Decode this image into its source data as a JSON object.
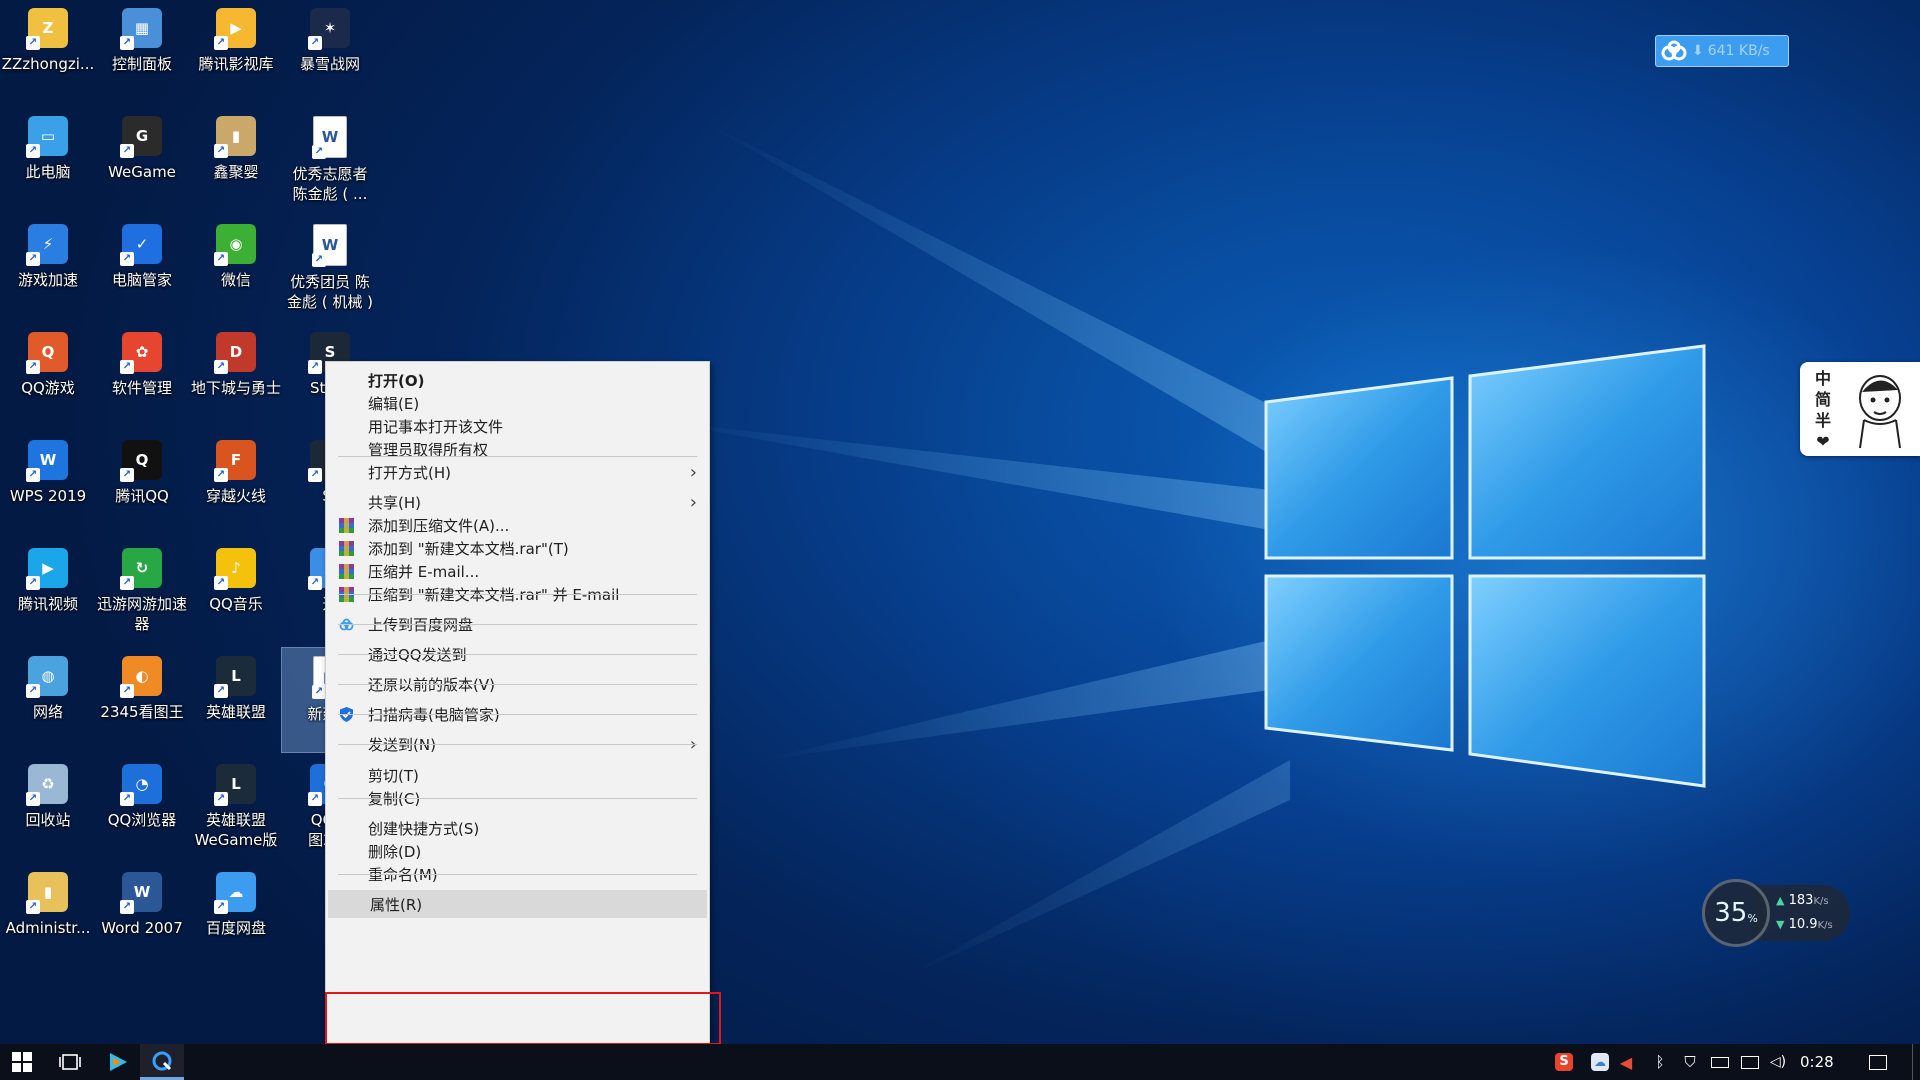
{
  "desktop_icons": [
    {
      "label": "ZZzhongzi...",
      "color": "#f0c040",
      "glyph": "Z"
    },
    {
      "label": "控制面板",
      "color": "#4a90d9",
      "glyph": "▦"
    },
    {
      "label": "腾讯影视库",
      "color": "#f5b830",
      "glyph": "▶"
    },
    {
      "label": "暴雪战网",
      "color": "#1b2a4a",
      "glyph": "✶"
    },
    {
      "label": "此电脑",
      "color": "#3aa0e8",
      "glyph": "▭"
    },
    {
      "label": "WeGame",
      "color": "#2b2b2b",
      "glyph": "G"
    },
    {
      "label": "鑫聚婴",
      "color": "#c9a86a",
      "glyph": "▮"
    },
    {
      "label": "优秀志愿者\n陈金彪 ( ...",
      "color": "#ffffff",
      "glyph": "W"
    },
    {
      "label": "游戏加速",
      "color": "#2a7de1",
      "glyph": "⚡"
    },
    {
      "label": "电脑管家",
      "color": "#1f6fe0",
      "glyph": "✓"
    },
    {
      "label": "微信",
      "color": "#3cb034",
      "glyph": "◉"
    },
    {
      "label": "优秀团员 陈\n金彪 ( 机械 )",
      "color": "#ffffff",
      "glyph": "W"
    },
    {
      "label": "QQ游戏",
      "color": "#e05a2a",
      "glyph": "Q"
    },
    {
      "label": "软件管理",
      "color": "#e6462f",
      "glyph": "✿"
    },
    {
      "label": "地下城与勇士",
      "color": "#c0392b",
      "glyph": "D"
    },
    {
      "label": "Stear",
      "color": "#1b2838",
      "glyph": "S"
    },
    {
      "label": "WPS 2019",
      "color": "#1f75e0",
      "glyph": "W"
    },
    {
      "label": "腾讯QQ",
      "color": "#111111",
      "glyph": "Q"
    },
    {
      "label": "穿越火线",
      "color": "#d9541e",
      "glyph": "F"
    },
    {
      "label": "St",
      "color": "#1b2838",
      "glyph": "S"
    },
    {
      "label": "腾讯视频",
      "color": "#1aa6e8",
      "glyph": "▶"
    },
    {
      "label": "迅游网游加速\n器",
      "color": "#28a745",
      "glyph": "↻"
    },
    {
      "label": "QQ音乐",
      "color": "#f4c20d",
      "glyph": "♪"
    },
    {
      "label": "迅",
      "color": "#3a8ee6",
      "glyph": "X"
    },
    {
      "label": "网络",
      "color": "#4aa3df",
      "glyph": "◍"
    },
    {
      "label": "2345看图王",
      "color": "#f08a24",
      "glyph": "◐"
    },
    {
      "label": "英雄联盟",
      "color": "#1c2b3a",
      "glyph": "L"
    },
    {
      "label": "新建文",
      "color": "#ffffff",
      "glyph": "▤"
    },
    {
      "label": "回收站",
      "color": "#9ab7d3",
      "glyph": "♻"
    },
    {
      "label": "QQ浏览器",
      "color": "#1e6fd9",
      "glyph": "◔"
    },
    {
      "label": "英雄联盟\nWeGame版",
      "color": "#1c2b3a",
      "glyph": "L"
    },
    {
      "label": "QQ浏\n图201",
      "color": "#1e6fd9",
      "glyph": "Q"
    },
    {
      "label": "Administr...",
      "color": "#e8c15a",
      "glyph": "▮"
    },
    {
      "label": "Word 2007",
      "color": "#2b5797",
      "glyph": "W"
    },
    {
      "label": "百度网盘",
      "color": "#3b9cf0",
      "glyph": "☁"
    }
  ],
  "context_menu": {
    "items": [
      {
        "label": "打开(O)",
        "bold": true
      },
      {
        "label": "编辑(E)"
      },
      {
        "label": "用记事本打开该文件"
      },
      {
        "label": "管理员取得所有权"
      },
      {
        "label": "打开方式(H)",
        "submenu": true
      },
      {
        "label": "共享(H)",
        "submenu": true
      },
      {
        "label": "添加到压缩文件(A)...",
        "icon": "winrar-icon"
      },
      {
        "label": "添加到 \"新建文本文档.rar\"(T)",
        "icon": "winrar-icon"
      },
      {
        "label": "压缩并 E-mail...",
        "icon": "winrar-icon"
      },
      {
        "label": "压缩到 \"新建文本文档.rar\" 并 E-mail",
        "icon": "winrar-icon"
      },
      {
        "label": "上传到百度网盘",
        "icon": "baidu-cloud-icon"
      },
      {
        "label": "通过QQ发送到"
      },
      {
        "label": "还原以前的版本(V)"
      },
      {
        "label": "扫描病毒(电脑管家)",
        "icon": "shield-icon"
      },
      {
        "label": "发送到(N)",
        "submenu": true
      },
      {
        "label": "剪切(T)"
      },
      {
        "label": "复制(C)"
      },
      {
        "label": "创建快捷方式(S)"
      },
      {
        "label": "删除(D)"
      },
      {
        "label": "重命名(M)"
      },
      {
        "label": "属性(R)",
        "highlighted": true
      }
    ]
  },
  "widgets": {
    "baidu_speed": "641 KB/s",
    "ime": [
      "中",
      "简",
      "半",
      "❤"
    ],
    "speed_percent": "35",
    "percent_sign": "%",
    "upload_rate": "183",
    "download_rate": "10.9",
    "rate_unit": "K/s"
  },
  "taskbar": {
    "clock": "0:28"
  },
  "colors": {
    "highlight_box": "#e01818",
    "menu_bg": "#f2f2f2",
    "taskbar_bg": "#0b0f19"
  }
}
